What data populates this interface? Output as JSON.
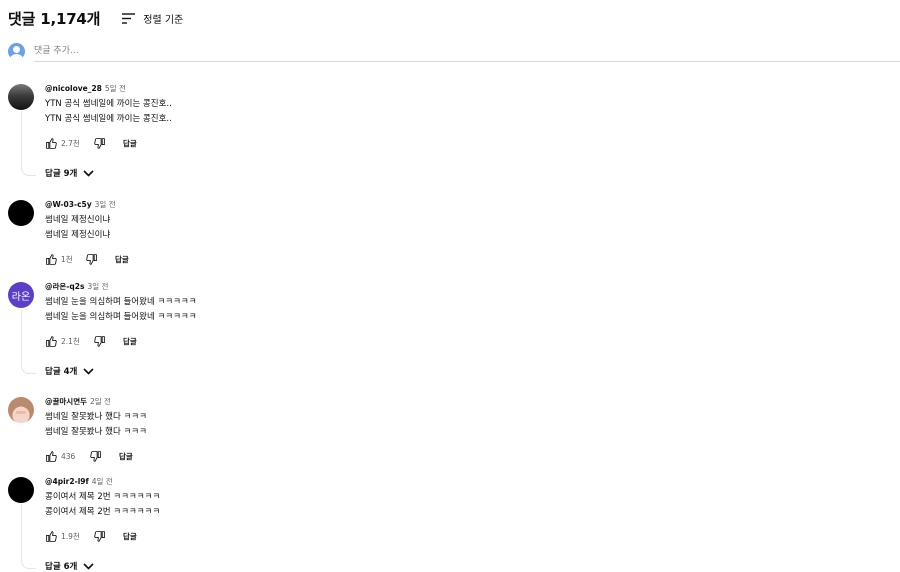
{
  "header": {
    "count_label": "댓글 1,174개",
    "sort_label": "정렬 기준",
    "sort_icon": "sort-icon"
  },
  "add_comment": {
    "placeholder": "댓글 추가..."
  },
  "comments": [
    {
      "author": "@nicolove_28",
      "time": "5일 전",
      "lines": [
        "YTN 공식 썸네일에 까이는 콩진호..",
        "YTN 공식 썸네일에 까이는 콩진호.."
      ],
      "likes": "2.7천",
      "reply_label": "답글",
      "replies_label": "답글 9개"
    },
    {
      "author": "@W-03-c5y",
      "time": "3일 전",
      "lines": [
        "썸네일 제정신이냐",
        "썸네일 제정신이냐"
      ],
      "likes": "1천",
      "reply_label": "답글"
    },
    {
      "author": "@라온-q2s",
      "time": "3일 전",
      "avatar_text": "라온",
      "lines": [
        "썸네일 눈을 의심하며 들어왔네 ㅋㅋㅋㅋㅋ",
        "썸네일 눈을 의심하며 들어왔네 ㅋㅋㅋㅋㅋ"
      ],
      "likes": "2.1천",
      "reply_label": "답글",
      "replies_label": "답글 4개"
    },
    {
      "author": "@꿀마시면두",
      "time": "2일 전",
      "lines": [
        "썸네일 잘못봤나 했다 ㅋㅋㅋ",
        "썸네일 잘못봤나 했다 ㅋㅋㅋ"
      ],
      "likes": "436",
      "reply_label": "답글"
    },
    {
      "author": "@4pir2-l9f",
      "time": "4일 전",
      "lines": [
        "콩이여서 제목 2번 ㅋㅋㅋㅋㅋㅋ",
        "콩이여서 제목 2번 ㅋㅋㅋㅋㅋㅋ"
      ],
      "likes": "1.9천",
      "reply_label": "답글",
      "replies_label": "답글 6개"
    }
  ],
  "icons": {
    "like": "thumbs-up-icon",
    "dislike": "thumbs-down-icon",
    "expand": "chevron-down-icon"
  },
  "colors": {
    "text": "#0f0f0f",
    "secondary": "#606060",
    "avatar_purple": "#5b3fc6",
    "user_avatar": "#6aa0e6"
  }
}
